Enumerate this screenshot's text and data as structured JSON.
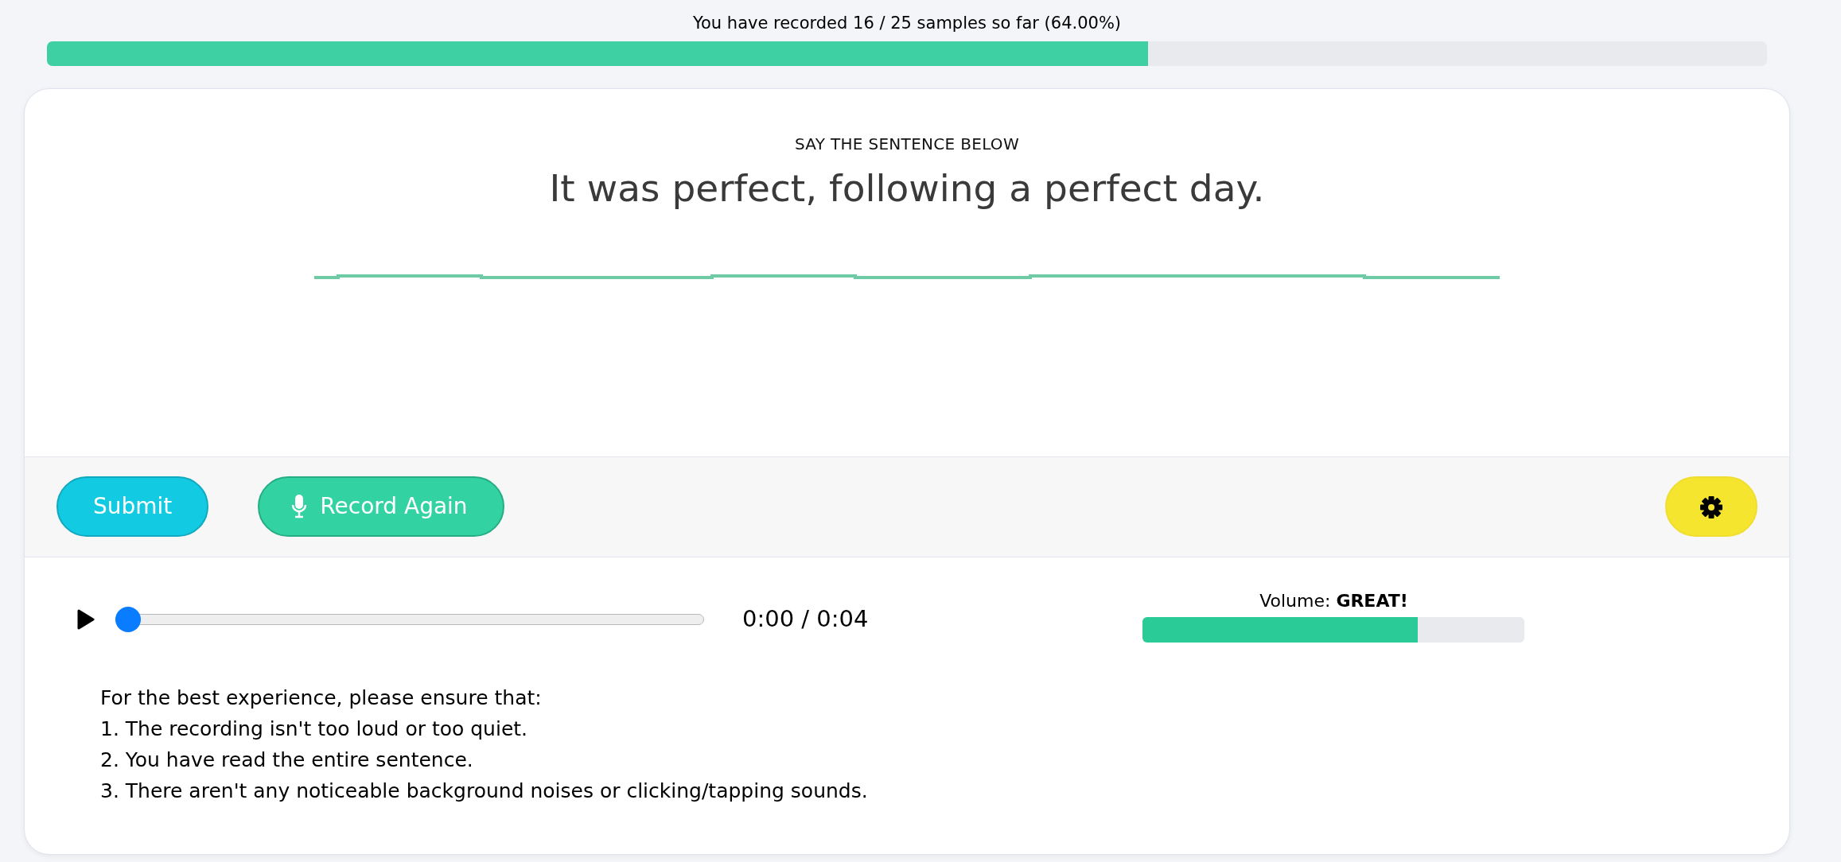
{
  "progress": {
    "text": "You have recorded 16 / 25 samples so far (64.00%)",
    "level": 0.64
  },
  "prompt": {
    "heading": "SAY THE SENTENCE BELOW",
    "sentence": "It was perfect, following a perfect day."
  },
  "actions": [
    {
      "label": "Submit",
      "kind": "submit"
    },
    {
      "label": "Record Again",
      "kind": "record"
    },
    {
      "kind": "settings"
    }
  ],
  "player": {
    "level": 0,
    "time": "0:00 / 0:04"
  },
  "volume": {
    "label": "Volume: **GREAT!**",
    "level": 0.72
  },
  "instructions": [
    "For the best experience, please ensure that:",
    "1. The recording isn't too loud or too quiet.",
    "2. You have read the entire sentence.",
    "3. There aren't any noticeable background noises or clicking/tapping sounds."
  ]
}
